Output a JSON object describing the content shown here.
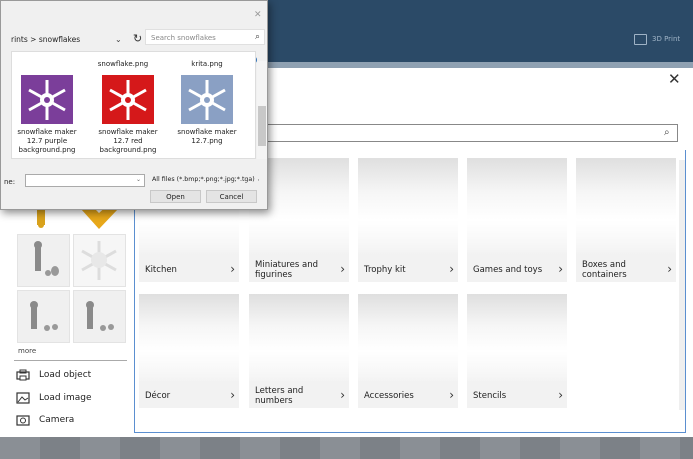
{
  "top_bar": {
    "title": "3D Print"
  },
  "search": {
    "placeholder": ""
  },
  "categories": [
    {
      "label": "Kitchen"
    },
    {
      "label": "Miniatures and figurines"
    },
    {
      "label": "Trophy kit"
    },
    {
      "label": "Games and toys"
    },
    {
      "label": "Boxes and containers"
    },
    {
      "label": "Décor"
    },
    {
      "label": "Letters and numbers"
    },
    {
      "label": "Accessories"
    },
    {
      "label": "Stencils"
    }
  ],
  "left_panel": {
    "more_label": "more",
    "actions": [
      {
        "label": "Load object",
        "icon": "printer-icon"
      },
      {
        "label": "Load image",
        "icon": "image-icon"
      },
      {
        "label": "Camera",
        "icon": "camera-icon"
      }
    ]
  },
  "file_dialog": {
    "breadcrumb": "rints  >  snowflakes",
    "search_placeholder": "Search snowflakes",
    "top_files": [
      "snowflake.png",
      "krita.png"
    ],
    "files": [
      {
        "name": "snowflake maker 12.7 purple background.png",
        "bg": "#7b3e9a"
      },
      {
        "name": "snowflake maker 12.7 red background.png",
        "bg": "#d5181a"
      },
      {
        "name": "snowflake maker 12.7.png",
        "bg": "#8aa0c4"
      }
    ],
    "filename_label": "ne:",
    "filename_value": "",
    "filetype": "All files (*.bmp;*.png;*.jpg;*.tga)",
    "open_label": "Open",
    "cancel_label": "Cancel"
  }
}
